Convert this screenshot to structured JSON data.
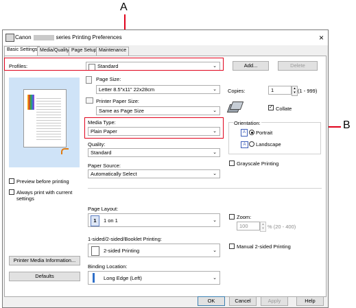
{
  "callouts": {
    "a": "A",
    "b": "B"
  },
  "window": {
    "title_prefix": "Canon",
    "title_suffix": "series Printing Preferences",
    "close": "×"
  },
  "tabs": [
    "Basic Settings",
    "Media/Quality",
    "Page Setup",
    "Maintenance"
  ],
  "profiles": {
    "label": "Profiles:",
    "value": "Standard",
    "add_button": "Add...",
    "delete_button": "Delete"
  },
  "page_size": {
    "label": "Page Size:",
    "value": "Letter 8.5\"x11\" 22x28cm"
  },
  "printer_paper_size": {
    "label": "Printer Paper Size:",
    "value": "Same as Page Size"
  },
  "media_type": {
    "label": "Media Type:",
    "value": "Plain Paper"
  },
  "quality": {
    "label": "Quality:",
    "value": "Standard"
  },
  "paper_source": {
    "label": "Paper Source:",
    "value": "Automatically Select"
  },
  "copies": {
    "label": "Copies:",
    "value": "1",
    "range": "(1 - 999)"
  },
  "collate": {
    "label": "Collate",
    "checked": true
  },
  "orientation": {
    "label": "Orientation:",
    "portrait": "Portrait",
    "landscape": "Landscape",
    "selected": "Portrait"
  },
  "grayscale": {
    "label": "Grayscale Printing",
    "checked": false
  },
  "preview": {
    "label": "Preview before printing",
    "checked": false
  },
  "always_print": {
    "label": "Always print with current settings",
    "checked": false
  },
  "page_layout": {
    "label": "Page Layout:",
    "value": "1 on 1",
    "badge": "1"
  },
  "zoom": {
    "label": "Zoom:",
    "value": "100",
    "range": "% (20 - 400)",
    "checked": false
  },
  "duplex": {
    "label": "1-sided/2-sided/Booklet Printing:",
    "value": "2-sided Printing"
  },
  "manual_duplex": {
    "label": "Manual 2-sided Printing",
    "checked": false
  },
  "binding": {
    "label": "Binding Location:",
    "value": "Long Edge (Left)"
  },
  "printer_media_info_button": "Printer Media Information...",
  "defaults_button": "Defaults",
  "footer": {
    "ok": "OK",
    "cancel": "Cancel",
    "apply": "Apply",
    "help": "Help"
  },
  "colors": {
    "callout": "#e0001a",
    "preview_bg": "#cfe3f7"
  }
}
